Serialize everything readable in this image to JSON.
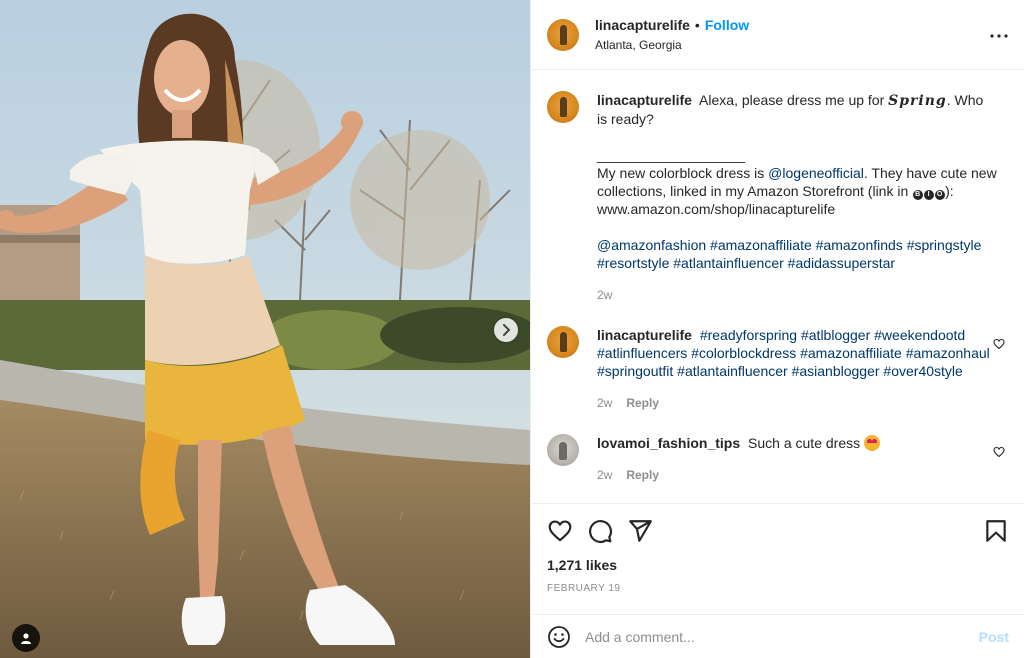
{
  "post": {
    "username": "linacapturelife",
    "follow_label": "Follow",
    "separator": "•",
    "location": "Atlanta, Georgia"
  },
  "caption": {
    "username": "linacapturelife",
    "text_before": "Alexa, please dress me up for",
    "styled_word": "Spring",
    "text_after": ". Who is ready?",
    "divider": "___________________",
    "line2_before": "My new colorblock dress is",
    "mention": "@logeneofficial",
    "line2_after": ". They have cute new collections, linked in my Amazon Storefront (link in",
    "bio_letters": [
      "B",
      "I",
      "O"
    ],
    "line2_end": "):",
    "url": "www.amazon.com/shop/linacapturelife",
    "hashtags": "@amazonfashion #amazonaffiliate #amazonfinds #springstyle #resortstyle #atlantainfluencer #adidassuperstar",
    "time": "2w"
  },
  "comments": [
    {
      "username": "linacapturelife",
      "text": "#readyforspring #atlblogger #weekendootd #atlinfluencers #colorblockdress #amazonaffiliate #amazonhaul #springoutfit #atlantainfluencer #asianblogger #over40style",
      "time": "2w",
      "reply_label": "Reply"
    },
    {
      "username": "lovamoi_fashion_tips",
      "text": "Such a cute dress",
      "emoji": "heart-eyes-emoji",
      "time": "2w",
      "reply_label": "Reply"
    }
  ],
  "stats": {
    "likes": "1,271 likes",
    "date": "FEBRUARY 19"
  },
  "composer": {
    "placeholder": "Add a comment...",
    "post_label": "Post"
  },
  "icons": {
    "more": "more-options-icon",
    "like": "heart-icon",
    "comment": "comment-bubble-icon",
    "share": "paper-plane-icon",
    "save": "bookmark-icon",
    "emoji": "smiley-icon",
    "next": "chevron-right-icon",
    "tags": "user-tag-icon"
  },
  "colors": {
    "accent": "#0095f6",
    "link": "#00376b",
    "muted": "#8e8e8e",
    "post_disabled": "#b2dffc"
  }
}
